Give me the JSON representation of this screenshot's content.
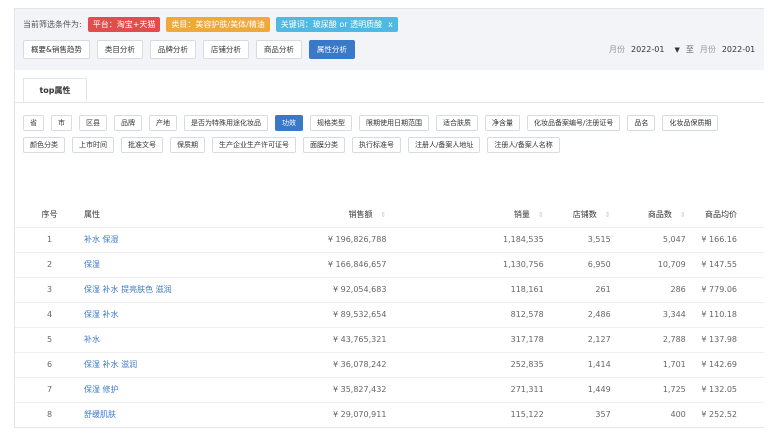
{
  "filters": {
    "label": "当前筛选条件为:",
    "chips": [
      {
        "text": "平台：淘宝+天猫",
        "color": "#e34c4c",
        "closable": false
      },
      {
        "text": "类目：美容护肤/美体/精油",
        "color": "#efa93a",
        "closable": false
      },
      {
        "text": "关键词：玻尿酸 or 透明质酸",
        "color": "#4fb9e3",
        "closable": true,
        "close_glyph": "x"
      }
    ]
  },
  "tabs": [
    "概要&销售趋势",
    "类目分析",
    "品牌分析",
    "店铺分析",
    "商品分析",
    "属性分析"
  ],
  "active_tab": "属性分析",
  "date_range": {
    "from_label": "月份",
    "from_value": "2022-01",
    "caret": "▼",
    "separator": "至",
    "to_label": "月份",
    "to_value": "2022-01"
  },
  "subtab": "top属性",
  "attributes_row1": [
    "省",
    "市",
    "区县",
    "品牌",
    "产地",
    "是否为特殊用途化妆品",
    "功效",
    "规格类型",
    "限期使用日期范围",
    "适合肤质",
    "净含量",
    "化妆品备案编号/注册证号",
    "品名",
    "化妆品保质期"
  ],
  "attributes_row2": [
    "颜色分类",
    "上市时间",
    "批准文号",
    "保质期",
    "生产企业生产许可证号",
    "面膜分类",
    "执行标准号",
    "注册人/备案人地址",
    "注册人/备案人名称"
  ],
  "active_attribute": "功效",
  "table": {
    "headers": {
      "index": "序号",
      "attribute": "属性",
      "sales": "销售额",
      "quantity": "销量",
      "stores": "店铺数",
      "products": "商品数",
      "avg_price": "商品均价"
    },
    "sort_glyph": "⇕",
    "rows": [
      {
        "index": "1",
        "attribute": "补水 保湿",
        "sales": "¥ 196,826,788",
        "quantity": "1,184,535",
        "stores": "3,515",
        "products": "5,047",
        "avg_price": "¥ 166.16"
      },
      {
        "index": "2",
        "attribute": "保湿",
        "sales": "¥ 166,846,657",
        "quantity": "1,130,756",
        "stores": "6,950",
        "products": "10,709",
        "avg_price": "¥ 147.55"
      },
      {
        "index": "3",
        "attribute": "保湿 补水 提亮肤色 滋润",
        "sales": "¥ 92,054,683",
        "quantity": "118,161",
        "stores": "261",
        "products": "286",
        "avg_price": "¥ 779.06"
      },
      {
        "index": "4",
        "attribute": "保湿 补水",
        "sales": "¥ 89,532,654",
        "quantity": "812,578",
        "stores": "2,486",
        "products": "3,344",
        "avg_price": "¥ 110.18"
      },
      {
        "index": "5",
        "attribute": "补水",
        "sales": "¥ 43,765,321",
        "quantity": "317,178",
        "stores": "2,127",
        "products": "2,788",
        "avg_price": "¥ 137.98"
      },
      {
        "index": "6",
        "attribute": "保湿 补水 滋润",
        "sales": "¥ 36,078,242",
        "quantity": "252,835",
        "stores": "1,414",
        "products": "1,701",
        "avg_price": "¥ 142.69"
      },
      {
        "index": "7",
        "attribute": "保湿 修护",
        "sales": "¥ 35,827,432",
        "quantity": "271,311",
        "stores": "1,449",
        "products": "1,725",
        "avg_price": "¥ 132.05"
      },
      {
        "index": "8",
        "attribute": "舒缓肌肤",
        "sales": "¥ 29,070,911",
        "quantity": "115,122",
        "stores": "357",
        "products": "400",
        "avg_price": "¥ 252.52"
      }
    ]
  }
}
